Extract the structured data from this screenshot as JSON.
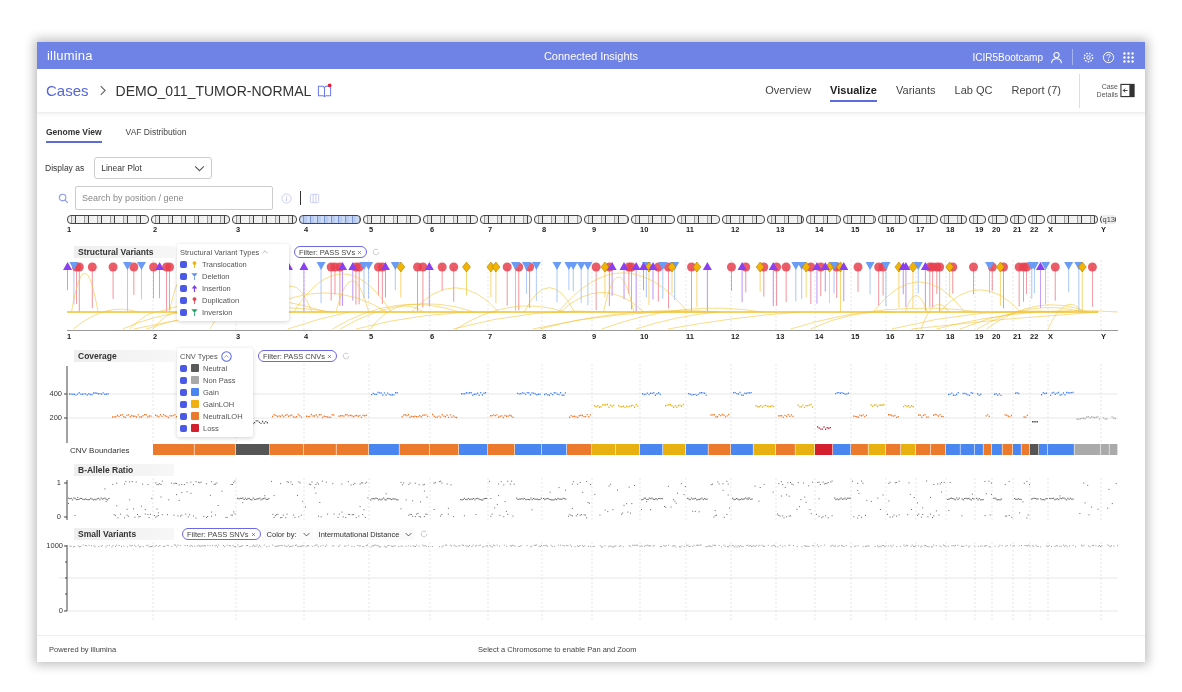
{
  "header": {
    "brand": "illumina",
    "title": "Connected Insights",
    "user": "ICIR5Bootcamp"
  },
  "breadcrumb": {
    "parent": "Cases",
    "case": "DEMO_011_TUMOR-NORMAL"
  },
  "nav": [
    {
      "label": "Overview",
      "selected": false
    },
    {
      "label": "Visualize",
      "selected": true
    },
    {
      "label": "Variants",
      "selected": false
    },
    {
      "label": "Lab QC",
      "selected": false
    },
    {
      "label": "Report (7)",
      "selected": false
    }
  ],
  "case_details": "Case Details",
  "subtabs": [
    {
      "label": "Genome View",
      "selected": true
    },
    {
      "label": "VAF Distribution",
      "selected": false
    }
  ],
  "display_as": {
    "label": "Display as",
    "value": "Linear Plot"
  },
  "search": {
    "placeholder": "Search by position / gene"
  },
  "ideogram": {
    "end_label": "q13",
    "chromosomes": [
      {
        "label": "1",
        "selected": false
      },
      {
        "label": "2",
        "selected": false
      },
      {
        "label": "3",
        "selected": false
      },
      {
        "label": "4",
        "selected": true
      },
      {
        "label": "5",
        "selected": false
      },
      {
        "label": "6",
        "selected": false
      },
      {
        "label": "7",
        "selected": false
      },
      {
        "label": "8",
        "selected": false
      },
      {
        "label": "9",
        "selected": false
      },
      {
        "label": "10",
        "selected": false
      },
      {
        "label": "11",
        "selected": false
      },
      {
        "label": "12",
        "selected": false
      },
      {
        "label": "13",
        "selected": false
      },
      {
        "label": "14",
        "selected": false
      },
      {
        "label": "15",
        "selected": false
      },
      {
        "label": "16",
        "selected": false
      },
      {
        "label": "17",
        "selected": false
      },
      {
        "label": "18",
        "selected": false
      },
      {
        "label": "19",
        "selected": false
      },
      {
        "label": "20",
        "selected": false
      },
      {
        "label": "21",
        "selected": false
      },
      {
        "label": "22",
        "selected": false
      },
      {
        "label": "X",
        "selected": false
      },
      {
        "label": "Y",
        "selected": false
      }
    ]
  },
  "structural_variants": {
    "title": "Structural Variants",
    "legend_title": "Structural Variant Types",
    "legend": [
      {
        "label": "Translocation",
        "checked": true,
        "kind": "translocation",
        "color": "#f2b400"
      },
      {
        "label": "Deletion",
        "checked": true,
        "kind": "deletion",
        "color": "#5b8ff5"
      },
      {
        "label": "Insertion",
        "checked": true,
        "kind": "insertion",
        "color": "#7a3cf0"
      },
      {
        "label": "Duplication",
        "checked": true,
        "kind": "duplication",
        "color": "#e8404f"
      },
      {
        "label": "Inversion",
        "checked": true,
        "kind": "inversion",
        "color": "#1aa35a"
      }
    ],
    "filter": "Filter: PASS SVs",
    "axis_labels": [
      "1",
      "2",
      "3",
      "4",
      "5",
      "6",
      "7",
      "8",
      "9",
      "10",
      "11",
      "12",
      "13",
      "14",
      "15",
      "16",
      "17",
      "18",
      "19",
      "20",
      "21",
      "22",
      "X",
      "Y"
    ]
  },
  "coverage": {
    "title": "Coverage",
    "legend_title": "CNV Types",
    "legend": [
      {
        "label": "Neutral",
        "checked": true,
        "color": "#5a5a5a"
      },
      {
        "label": "Non Pass",
        "checked": true,
        "color": "#a8a8a8"
      },
      {
        "label": "Gain",
        "checked": true,
        "color": "#4a86f0"
      },
      {
        "label": "GainLOH",
        "checked": true,
        "color": "#f0b010"
      },
      {
        "label": "NeutralLOH",
        "checked": true,
        "color": "#ec7a2c"
      },
      {
        "label": "Loss",
        "checked": true,
        "color": "#d4202e"
      }
    ],
    "filter": "Filter: PASS CNVs",
    "yticks": [
      "400",
      "200"
    ],
    "boundaries_label": "CNV Boundaries"
  },
  "b_allele_ratio": {
    "title": "B-Allele Ratio",
    "yticks": [
      "1",
      "0"
    ]
  },
  "small_variants": {
    "title": "Small Variants",
    "filter": "Filter: PASS SNVs",
    "color_by_label": "Color by:",
    "color_by_value": "Intermutational Distance",
    "yticks": [
      "1000",
      "0"
    ]
  },
  "footer": {
    "powered_by": "Powered by illumina",
    "hint": "Select a Chromosome to enable Pan and Zoom"
  }
}
